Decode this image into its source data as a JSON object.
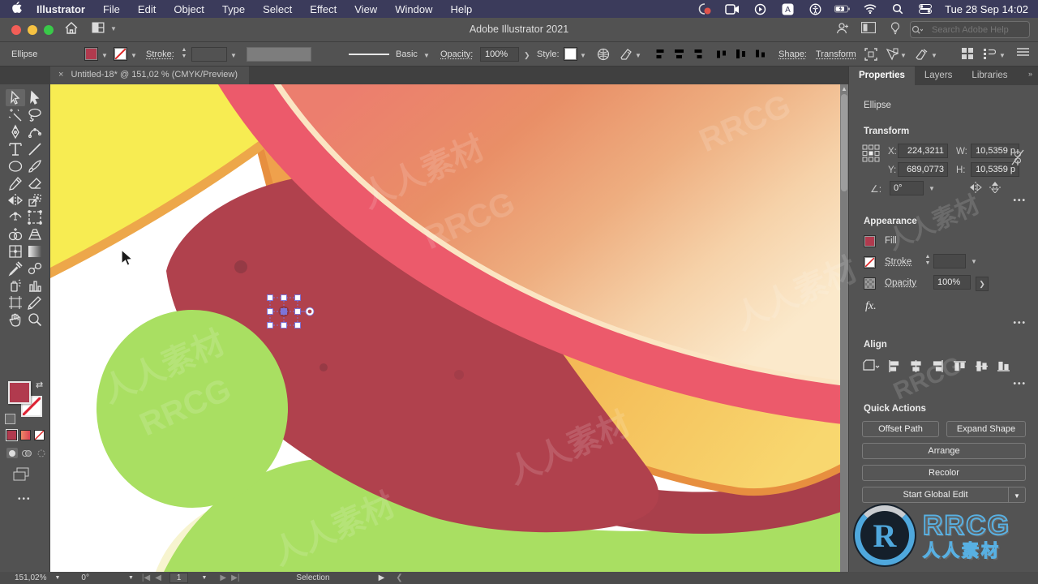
{
  "menu_bar": {
    "items": [
      "Illustrator",
      "File",
      "Edit",
      "Object",
      "Type",
      "Select",
      "Effect",
      "View",
      "Window",
      "Help"
    ],
    "clock": "Tue 28 Sep  14:02",
    "status_icons": [
      "screen-record-icon",
      "camera-icon",
      "play-icon",
      "input-source-icon",
      "accessibility-icon",
      "battery-icon",
      "wifi-icon",
      "search-icon",
      "control-center-icon"
    ]
  },
  "title_bar": {
    "title": "Adobe Illustrator 2021",
    "search_placeholder": "Search Adobe Help",
    "icons": [
      "home-icon",
      "layout-icon",
      "share-icon",
      "arrange-docs-icon",
      "lightbulb-icon"
    ]
  },
  "control_bar": {
    "tool_name": "Ellipse",
    "stroke_label": "Stroke:",
    "basic_label": "Basic",
    "opacity_label": "Opacity:",
    "opacity_value": "100%",
    "style_label": "Style:",
    "shape_label": "Shape:",
    "transform_label": "Transform",
    "fill_color": "#b13a4e"
  },
  "doc_tab": {
    "title": "Untitled-18* @ 151,02 % (CMYK/Preview)"
  },
  "toolbar_tools": [
    "selection",
    "direct-selection",
    "magic-wand",
    "lasso",
    "pen",
    "curvature",
    "type",
    "line-segment",
    "ellipse",
    "paintbrush",
    "pencil",
    "eraser",
    "reflect",
    "scale",
    "width",
    "free-transform",
    "shape-builder",
    "perspective-grid",
    "mesh",
    "gradient",
    "eyedropper",
    "blend",
    "symbol-sprayer",
    "graph",
    "artboard",
    "slice",
    "hand",
    "zoom"
  ],
  "panel": {
    "tabs": [
      "Properties",
      "Layers",
      "Libraries"
    ],
    "object_type": "Ellipse",
    "transform": {
      "heading": "Transform",
      "x_label": "X:",
      "x_value": "224,3211",
      "y_label": "Y:",
      "y_value": "689,0773",
      "w_label": "W:",
      "w_value": "10,5359 p",
      "h_label": "H:",
      "h_value": "10,5359 p",
      "angle_value": "0°"
    },
    "appearance": {
      "heading": "Appearance",
      "fill_label": "Fill",
      "stroke_label": "Stroke",
      "opacity_label": "Opacity",
      "opacity_value": "100%",
      "fx_label": "fx."
    },
    "align": {
      "heading": "Align"
    },
    "quick_actions": {
      "heading": "Quick Actions",
      "buttons": [
        "Offset Path",
        "Expand Shape",
        "Arrange",
        "Recolor"
      ],
      "global_edit": "Start Global Edit"
    }
  },
  "status_bar": {
    "zoom": "151,02%",
    "rotation": "0°",
    "artboard": "1",
    "selection_label": "Selection"
  },
  "artwork": {
    "artboard_bg": "#ffffff",
    "yellow_slice": "#f7ec52",
    "yellow_edge": "#eda74a",
    "bun_gradient": [
      "#ec7e6e",
      "#e98f67",
      "#eeae80",
      "#f6d2a9",
      "#fbe9cb"
    ],
    "cream_ring": "#fbe5c3",
    "pink_band": "#ec5a6b",
    "patty": "#b0414d",
    "patty_dots": "#953a45",
    "cheese": [
      "#efa14c",
      "#f8d76f"
    ],
    "cheese_edge": "#e78f3f",
    "lettuce": "#a9df62",
    "pale_bun": "#f7f4cf",
    "selection_accent": "#7d74d8"
  },
  "watermark": {
    "tile_text": "人人素材 RRCG",
    "logo_text": "RRCG",
    "logo_cn": "人人素材",
    "logo_color": "#58b0e2"
  }
}
